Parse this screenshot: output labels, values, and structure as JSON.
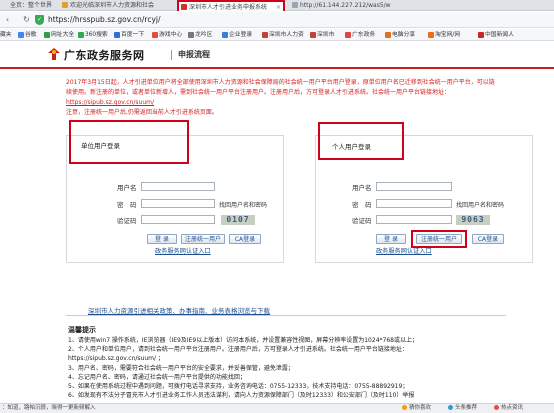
{
  "browser": {
    "tabs": [
      {
        "label": "全页：整个世界",
        "active": false
      },
      {
        "label": "欢迎光临深圳市人力资源和社会",
        "active": false
      },
      {
        "label": "深圳市人才引进业务申报系统",
        "active": true
      },
      {
        "label": "http://61.144.227.212/was5/w",
        "active": false
      }
    ],
    "url": "https://hrsspub.sz.gov.cn/rcyj/",
    "bookmarks": [
      "藏夹",
      "谷歌",
      "网址大全",
      "360搜索",
      "百度一下",
      "游戏中心",
      "龙吟区",
      "企业登录",
      "深圳市人力资",
      "深圳市",
      "广东政务",
      "电脑分享",
      "淘宝网/网",
      "中国新闻人"
    ]
  },
  "header": {
    "site_title": "广东政务服务网",
    "sub_title": "申报流程"
  },
  "notice": {
    "line1": "2017年3月15日起，人才引进单位用户将全部使用深圳市人力资源和社会保障局的社会统一用户平台用户登录，原单位用户名已迁移到社会统一用户平台，可以链",
    "line2": "续使用。新注册的单位，或者单位新增人，需到社会统一用户平台注册用户。注册用户后，方可登录人才引进系统。社会统一用户平台链接地址：",
    "link": "https://sipub.sz.gov.cn/suum/",
    "line3": "注意，注册统一用户后,仍需返回当前人才引进系统页面。"
  },
  "unit_login": {
    "title": "单位用户登录",
    "username_label": "用户名",
    "password_label": "密　码",
    "find_link": "找回用户名和密码",
    "captcha_label": "验证码",
    "captcha_code": "0107",
    "login_btn": "登 录",
    "register_btn": "注册统一用户",
    "ca_btn": "CA登录",
    "auth_link": "政务服务网认证入口"
  },
  "personal_login": {
    "title": "个人用户登录",
    "username_label": "用户名",
    "password_label": "密　码",
    "find_link": "找回用户名和密码",
    "captcha_label": "验证码",
    "captcha_code": "9063",
    "login_btn": "登 录",
    "register_btn": "注册统一用户",
    "ca_btn": "CA登录",
    "auth_link": "政务服务网认证入口"
  },
  "links_row": "深圳市人力资源引进相关政策、办事指南、业务表格浏览与下载",
  "tips": {
    "title": "温馨提示",
    "items": [
      "1、请使用win7 操作系统，IE浏览器（IE9及IE9以上版本）访问本系统，并设置兼容性视图，屏幕分辨率设置为1024*768或以上；",
      "2、个人用户和单位用户，请到社会统一用户平台注册用户。注册用户后，方可登录人才引进系统。社会统一用户平台链接地址：",
      "https://sipub.sz.gov.cn/suum/ ；",
      "3、用户名、密码，需要符合社会统一用户平台的安全要求，并妥善保管，避免泄露；",
      "4、忘记用户名、密码，请通过社会统一用户平台提供的功能找回；",
      "5、如果在使用系统过程中遇到问题，可拨打电话寻求支持，业务咨询电话：0755-12333，技术支持电话：0755-88892919；",
      "6、如发现有不法分子冒充市人才引进业务工作人员违法谋利，请向人力资源保障部门（及时12333）和公安部门（及时110）举报"
    ]
  },
  "statusbar": {
    "left": "：知道，路帕沉很，晓得一更新频解入",
    "items": [
      "猜你喜欢",
      "头条推荐",
      "热点资讯"
    ]
  },
  "colors": {
    "accent_red": "#d0021b",
    "link_blue": "#1e4f8f",
    "notice_red": "#d02020"
  }
}
